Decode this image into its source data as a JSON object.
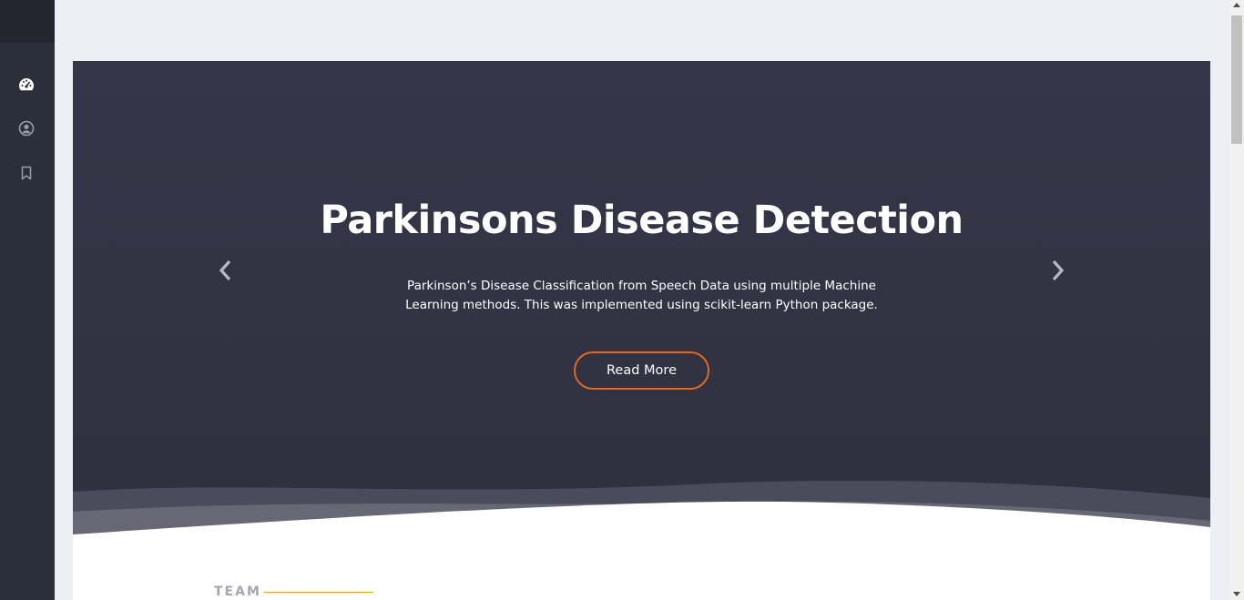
{
  "sidebar": {
    "items": [
      {
        "icon": "dashboard-icon"
      },
      {
        "icon": "user-circle-icon"
      },
      {
        "icon": "bookmark-icon"
      }
    ]
  },
  "hero": {
    "title": "Parkinsons Disease Detection",
    "description": "Parkinson’s Disease Classification from Speech Data using multiple Machine Learning methods. This was implemented using scikit-learn Python package.",
    "button_label": "Read More",
    "prev_icon": "chevron-left-icon",
    "next_icon": "chevron-right-icon"
  },
  "section": {
    "label": "TEAM"
  },
  "colors": {
    "sidebar": "#2b2f3a",
    "hero_bg": "#353749",
    "accent": "#e2681b",
    "team_line": "#e2a31b"
  }
}
